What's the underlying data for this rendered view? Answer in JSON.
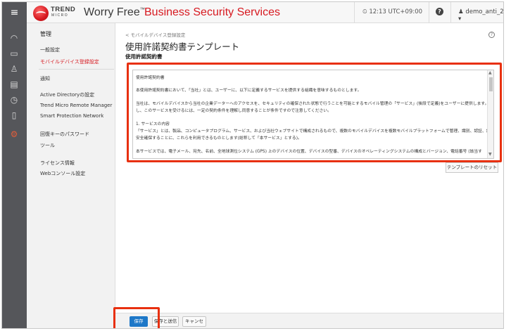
{
  "header": {
    "logo_trend": "TREND",
    "logo_micro": "MICRO",
    "brand_name": "Worry Free",
    "brand_tm": "™",
    "brand_suffix": "Business Security Services",
    "clock": "12:13 UTC+09:00",
    "help": "?",
    "user": "demo_anti_2"
  },
  "rail": {
    "icons": [
      "dashboard-icon",
      "devices-icon",
      "users-icon",
      "reports-icon",
      "clock-icon",
      "document-icon",
      "settings-icon"
    ]
  },
  "nav": {
    "heading": "管理",
    "items": [
      {
        "label": "一般設定"
      },
      {
        "label": "モバイルデバイス登録設定"
      },
      {
        "label": "通知"
      },
      {
        "label": "Active Directoryの設定"
      },
      {
        "label": "Trend Micro Remote Manager"
      },
      {
        "label": "Smart Protection Network"
      },
      {
        "label": "回復キーのパスワード"
      },
      {
        "label": "ツール"
      },
      {
        "label": "ライセンス情報"
      },
      {
        "label": "Webコンソール設定"
      }
    ]
  },
  "main": {
    "breadcrumb": "< モバイルデバイス登録設定",
    "title": "使用許諾契約書テンプレート",
    "subhead": "使用許諾契約書",
    "help": "?",
    "agreement_lines": [
      "使用許諾契約書",
      "本使用許諾契約書において、「当社」とは、ユーザーに、以下に定義するサービスを提供する組織を意味するものとします。",
      "当社は、モバイルデバイスから当社の企業データーへのアクセスを、セキュリティの確保された状態で行うことを可能とするモバイル管理の「サービス」(後段で定義)をユーザーに提供します。ただ",
      "し、このサービスを受けるには、一定の契約条件を理解し同意することが条件ですので注意してください。",
      "1. サービスの内容",
      "「サービス」とは、製品、コンピュータプログラム、サービス、および当社ウェブサイトで構成されるもので、複数のモバイルデバイスを複数モバイルプラットフォームで管理、識別、認証、設定、",
      "安全確保することに、これらを利用できるものとします(総称して「本サービス」とする)。",
      "本サービスでは、電子メール、宛先、名前、全地球測位システム (GPS) 上のデバイスの位置、デバイスの型番、デバイスのオペレーティングシステムの構成とバージョン、電話番号 (該当す"
    ],
    "reset_button": "テンプレートのリセット",
    "save_button": "保存",
    "save_send_button": "保存と送信",
    "cancel_button": "キャンセル"
  },
  "colors": {
    "brand_red": "#d71920",
    "save_blue": "#1e78c8",
    "annotation_red": "#e8300f",
    "rail_gray": "#55565a"
  }
}
